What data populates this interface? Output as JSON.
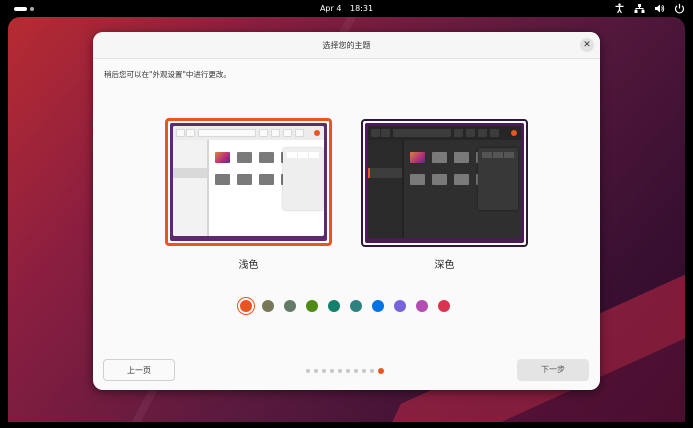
{
  "topbar": {
    "date": "Apr 4",
    "time": "18:31",
    "icons": [
      "accessibility-icon",
      "network-icon",
      "volume-icon",
      "power-icon"
    ]
  },
  "dialog": {
    "title": "选择您的主题",
    "close_label": "✕",
    "hint": "稍后您可以在\"外观设置\"中进行更改。",
    "themes": [
      {
        "label": "浅色",
        "selected": true
      },
      {
        "label": "深色",
        "selected": false
      }
    ],
    "accent_colors": [
      "#e95420",
      "#787859",
      "#657b69",
      "#4e8a14",
      "#12806b",
      "#308280",
      "#0073e5",
      "#7764d8",
      "#b34cb3",
      "#da3450"
    ],
    "selected_accent": 0,
    "pager": {
      "total": 10,
      "current": 10
    },
    "back_label": "上一页",
    "next_label": "下一步"
  },
  "colors": {
    "accent": "#e95420"
  }
}
